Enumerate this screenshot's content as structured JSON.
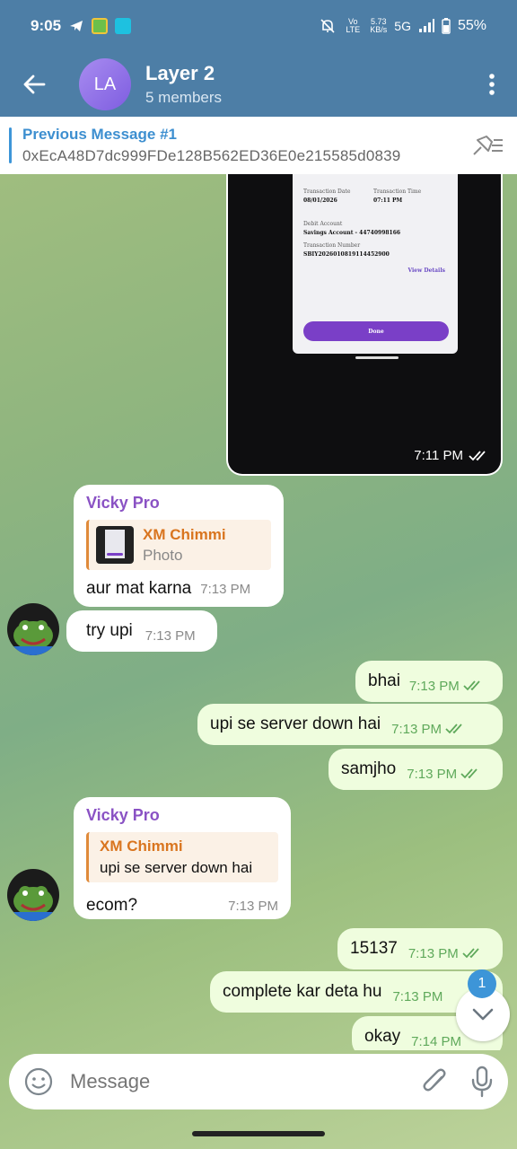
{
  "status_bar": {
    "time": "9:05",
    "speed_value": "5.73",
    "speed_unit": "KB/s",
    "network": "5G",
    "battery": "55%",
    "volte": "Vo LTE"
  },
  "header": {
    "avatar_initials": "LA",
    "title": "Layer 2",
    "subtitle": "5 members"
  },
  "pinned": {
    "title": "Previous Message #1",
    "body": "0xEcA48D7dc999FDe128B562ED36E0e215585d0839"
  },
  "photo_message": {
    "time": "7:11 PM",
    "receipt": {
      "transaction_date_label": "Transaction Date",
      "transaction_date": "08/01/2026",
      "transaction_time_label": "Transaction Time",
      "transaction_time": "07:11 PM",
      "debit_account_label": "Debit Account",
      "debit_account": "Savings Account - 44740998166",
      "transaction_number_label": "Transaction Number",
      "transaction_number": "SBIY2026010819114452900",
      "view_details": "View Details",
      "done_button": "Done"
    }
  },
  "messages": [
    {
      "sender": "Vicky Pro",
      "reply_name": "XM Chimmi",
      "reply_text": "Photo",
      "text": "aur mat karna",
      "time": "7:13 PM"
    },
    {
      "text": "try upi",
      "time": "7:13 PM"
    },
    {
      "text": "bhai",
      "time": "7:13 PM"
    },
    {
      "text": "upi se server down hai",
      "time": "7:13 PM"
    },
    {
      "text": "samjho",
      "time": "7:13 PM"
    },
    {
      "sender": "Vicky Pro",
      "reply_name": "XM Chimmi",
      "reply_text": "upi se server down hai",
      "text": "ecom?",
      "time": "7:13 PM"
    },
    {
      "text": "15137",
      "time": "7:13 PM"
    },
    {
      "text": "complete kar deta hu",
      "time": "7:13 PM"
    },
    {
      "text": "okay",
      "time": "7:14 PM"
    }
  ],
  "scroll_badge": "1",
  "composer": {
    "placeholder": "Message"
  },
  "colors": {
    "header_bg": "#4d7ea6",
    "outgoing_bubble": "#effdde",
    "incoming_bubble": "#ffffff",
    "sender_name": "#8a52c4",
    "reply_name": "#d9751f",
    "accent": "#3d95d8"
  },
  "icons": {
    "back": "arrow-left-icon",
    "menu": "more-vertical-icon",
    "pin_list": "pin-list-icon",
    "emoji": "emoji-icon",
    "attach": "paperclip-icon",
    "mic": "microphone-icon",
    "scroll_down": "chevron-down-icon",
    "read": "double-check-icon"
  }
}
